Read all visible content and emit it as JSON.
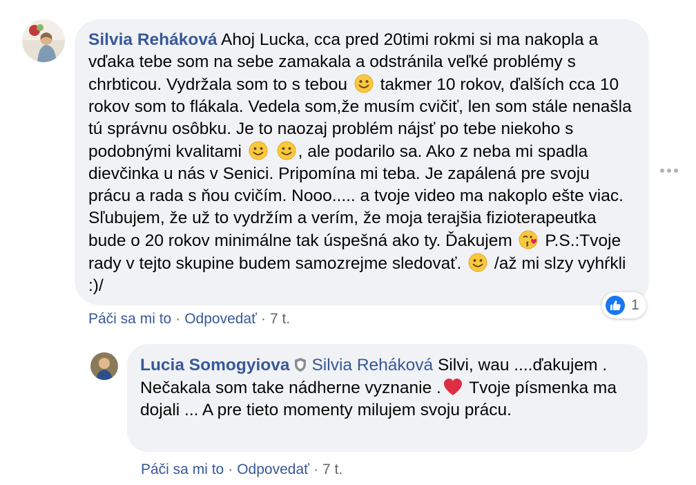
{
  "comments": [
    {
      "author": "Silvia Reháková",
      "segments": [
        "Ahoj Lucka, cca pred 20timi rokmi si ma nakopla a vďaka tebe som na sebe zamakala a odstránila veľké problémy s chrbticou. Vydržala som to s tebou",
        "takmer 10 rokov, ďalších cca 10 rokov som to flákala. Vedela som,že musím cvičiť, len som stále nenašla tú správnu osôbku. Je to naozaj problém nájsť po tebe niekoho s podobnými kvalitami",
        ", ale podarilo sa. Ako z neba mi spadla dievčinka u nás v Senici. Pripomína mi teba. Je zapálená pre svoju prácu a rada s ňou cvičím. Nooo..... a tvoje video ma nakoplo ešte viac. Sľubujem, že už to vydržím a verím, že moja terajšia fizioterapeutka bude o 20 rokov minimálne tak úspešná ako ty. Ďakujem",
        "P.S.:Tvoje rady v tejto skupine budem samozrejme sledovať.",
        "/až mi slzy vyhŕkli :)/"
      ],
      "emoji_icons": [
        "smile-emoji-icon",
        "smile-emoji-icon",
        "kiss-heart-emoji-icon",
        "smile-emoji-icon"
      ],
      "actions": {
        "like": "Páči sa mi to",
        "separator": "·",
        "reply": "Odpovedať",
        "time": "7 t."
      },
      "reactions": {
        "icon": "like-icon",
        "count": "1"
      }
    },
    {
      "author": "Lucia Somogyiova",
      "author_badge": "shield-icon",
      "mention": "Silvia Reháková",
      "segments": [
        "Silvi, wau ....ďakujem . Nečakala som take nádherne vyznanie .",
        "Tvoje písmenka ma dojali ... A pre tieto momenty milujem svoju prácu."
      ],
      "emoji_icons": [
        "red-heart-emoji-icon"
      ],
      "actions": {
        "like": "Páči sa mi to",
        "separator": "·",
        "reply": "Odpovedať",
        "time": "7 t."
      }
    }
  ],
  "colors": {
    "bubble": "#f0f2f5",
    "link": "#385898",
    "meta": "#65676b",
    "like_blue": "#1877f2"
  }
}
